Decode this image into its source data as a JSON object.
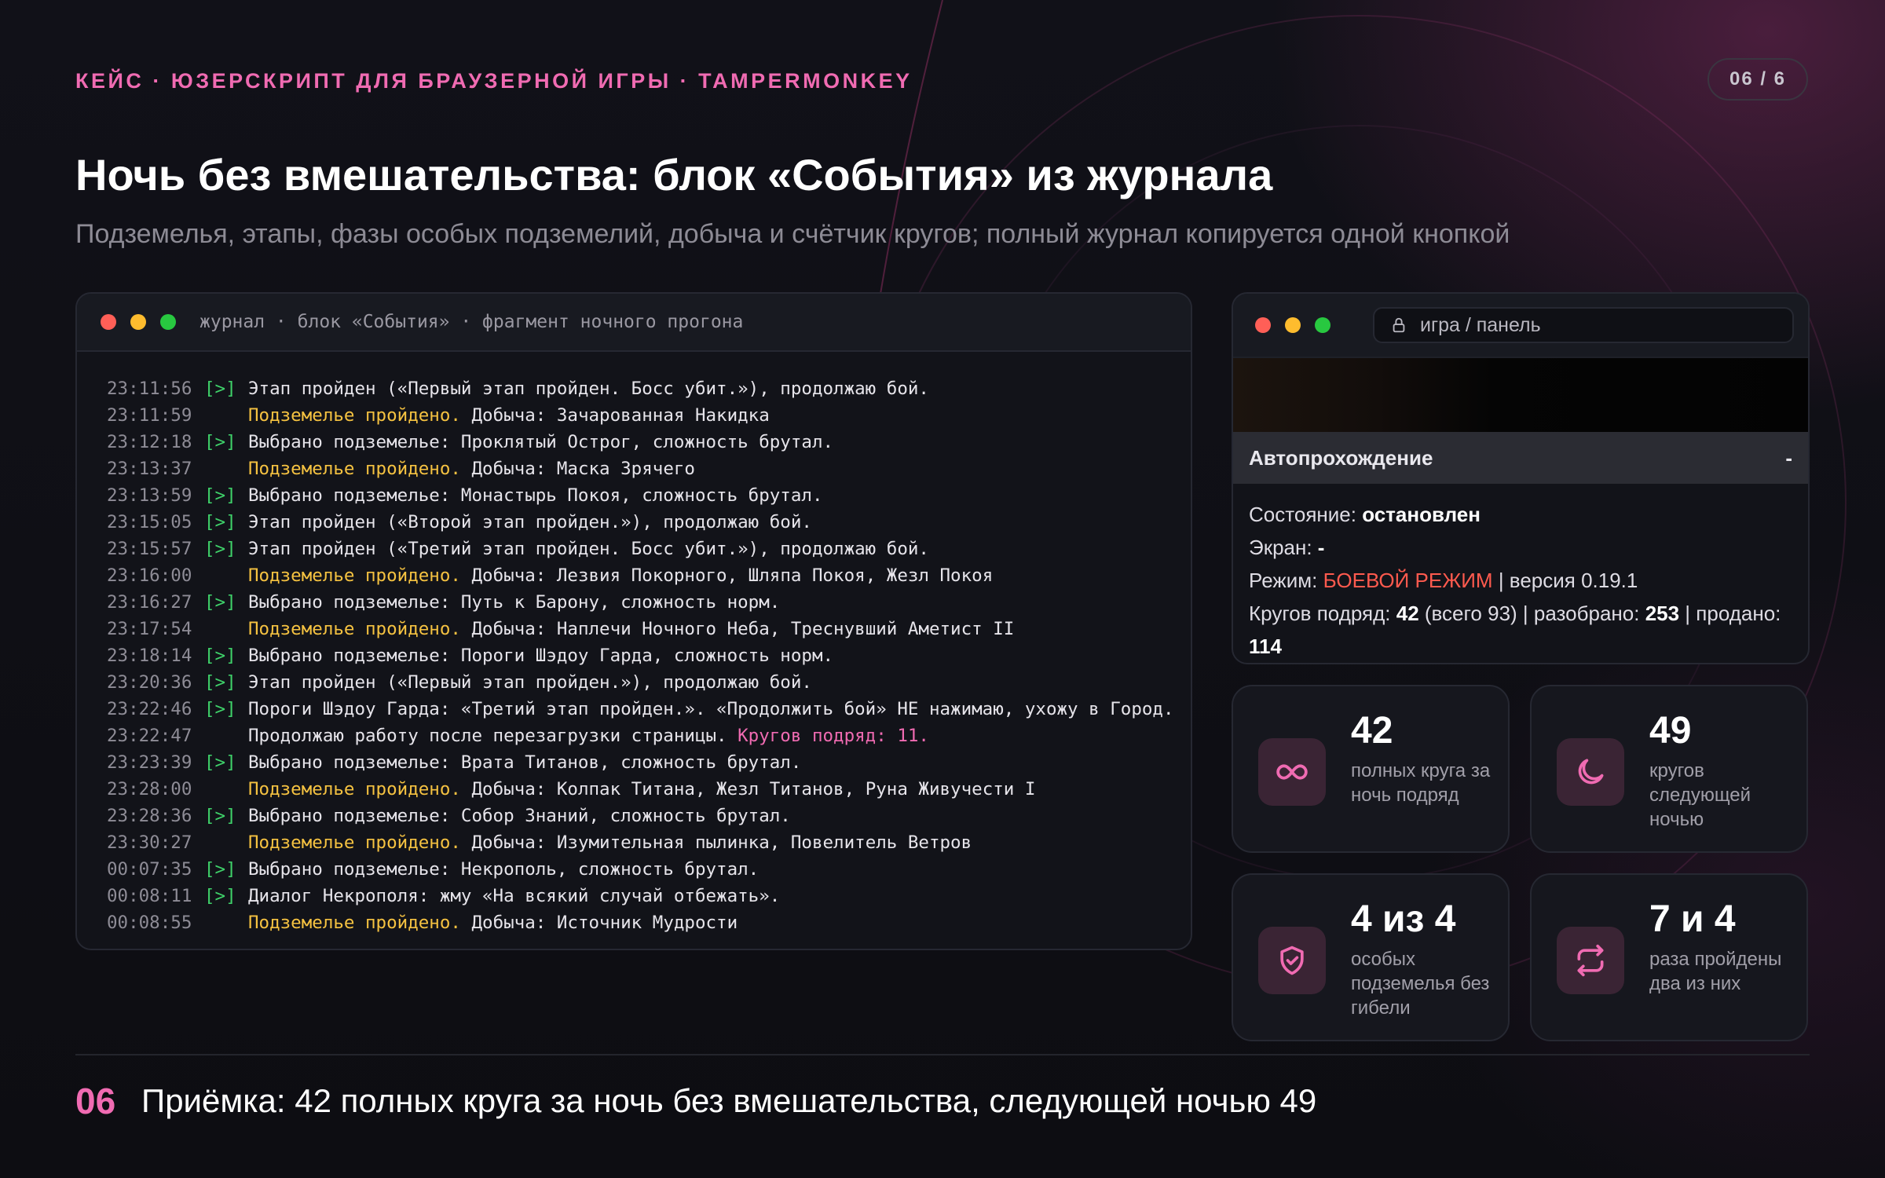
{
  "header": {
    "eyebrow": "КЕЙС · ЮЗЕРСКРИПТ ДЛЯ БРАУЗЕРНОЙ ИГРЫ · TAMPERMONKEY",
    "counter": "06 / 6",
    "title": "Ночь без вмешательства: блок «События» из журнала",
    "subtitle": "Подземелья, этапы, фазы особых подземелий, добыча и счётчик кругов; полный журнал копируется одной кнопкой"
  },
  "terminal": {
    "title": "журнал · блок «События» · фрагмент ночного прогона",
    "lines": [
      {
        "time": "23:11:56",
        "marker": "[>]",
        "done": "",
        "text": "Этап пройден («Первый этап пройден. Босс убит.»), продолжаю бой.",
        "count": ""
      },
      {
        "time": "23:11:59",
        "marker": "",
        "done": "Подземелье пройдено.",
        "text": " Добыча: Зачарованная Накидка",
        "count": ""
      },
      {
        "time": "23:12:18",
        "marker": "[>]",
        "done": "",
        "text": "Выбрано подземелье: Проклятый Острог, сложность брутал.",
        "count": ""
      },
      {
        "time": "23:13:37",
        "marker": "",
        "done": "Подземелье пройдено.",
        "text": " Добыча: Маска Зрячего",
        "count": ""
      },
      {
        "time": "23:13:59",
        "marker": "[>]",
        "done": "",
        "text": "Выбрано подземелье: Монастырь Покоя, сложность брутал.",
        "count": ""
      },
      {
        "time": "23:15:05",
        "marker": "[>]",
        "done": "",
        "text": "Этап пройден («Второй этап пройден.»), продолжаю бой.",
        "count": ""
      },
      {
        "time": "23:15:57",
        "marker": "[>]",
        "done": "",
        "text": "Этап пройден («Третий этап пройден. Босс убит.»), продолжаю бой.",
        "count": ""
      },
      {
        "time": "23:16:00",
        "marker": "",
        "done": "Подземелье пройдено.",
        "text": " Добыча: Лезвия Покорного, Шляпа Покоя, Жезл Покоя",
        "count": ""
      },
      {
        "time": "23:16:27",
        "marker": "[>]",
        "done": "",
        "text": "Выбрано подземелье: Путь к Барону, сложность норм.",
        "count": ""
      },
      {
        "time": "23:17:54",
        "marker": "",
        "done": "Подземелье пройдено.",
        "text": " Добыча: Наплечи Ночного Неба, Треснувший Аметист II",
        "count": ""
      },
      {
        "time": "23:18:14",
        "marker": "[>]",
        "done": "",
        "text": "Выбрано подземелье: Пороги Шэдоу Гарда, сложность норм.",
        "count": ""
      },
      {
        "time": "23:20:36",
        "marker": "[>]",
        "done": "",
        "text": "Этап пройден («Первый этап пройден.»), продолжаю бой.",
        "count": ""
      },
      {
        "time": "23:22:46",
        "marker": "[>]",
        "done": "",
        "text": "Пороги Шэдоу Гарда: «Третий этап пройден.». «Продолжить бой» НЕ нажимаю, ухожу в Город.",
        "count": ""
      },
      {
        "time": "23:22:47",
        "marker": "",
        "done": "",
        "text": "Продолжаю работу после перезагрузки страницы. ",
        "count": "Кругов подряд: 11."
      },
      {
        "time": "23:23:39",
        "marker": "[>]",
        "done": "",
        "text": "Выбрано подземелье: Врата Титанов, сложность брутал.",
        "count": ""
      },
      {
        "time": "23:28:00",
        "marker": "",
        "done": "Подземелье пройдено.",
        "text": " Добыча: Колпак Титана, Жезл Титанов, Руна Живучести I",
        "count": ""
      },
      {
        "time": "23:28:36",
        "marker": "[>]",
        "done": "",
        "text": "Выбрано подземелье: Собор Знаний, сложность брутал.",
        "count": ""
      },
      {
        "time": "23:30:27",
        "marker": "",
        "done": "Подземелье пройдено.",
        "text": " Добыча: Изумительная пылинка, Повелитель Ветров",
        "count": ""
      },
      {
        "time": "00:07:35",
        "marker": "[>]",
        "done": "",
        "text": "Выбрано подземелье: Некрополь, сложность брутал.",
        "count": ""
      },
      {
        "time": "00:08:11",
        "marker": "[>]",
        "done": "",
        "text": "Диалог Некрополя: жму «На всякий случай отбежать».",
        "count": ""
      },
      {
        "time": "00:08:55",
        "marker": "",
        "done": "Подземелье пройдено.",
        "text": " Добыча: Источник Мудрости",
        "count": ""
      }
    ]
  },
  "panel": {
    "url": "игра / панель",
    "header_title": "Автопрохождение",
    "collapse_label": "-",
    "state_label": "Состояние: ",
    "state_value": "остановлен",
    "screen_label": "Экран: ",
    "screen_value": "-",
    "mode_label": "Режим: ",
    "mode_value": "БОЕВОЙ РЕЖИМ",
    "mode_version": " | версия 0.19.1",
    "laps_label": "Кругов подряд: ",
    "laps_value": "42",
    "laps_total": " (всего 93) | разобрано: ",
    "disassembled_value": "253",
    "sold_label": " | продано:",
    "sold_value": "114"
  },
  "stats": [
    {
      "value": "42",
      "label": "полных круга за ночь подряд",
      "icon": "infinity-icon"
    },
    {
      "value": "49",
      "label": "кругов следующей ночью",
      "icon": "moon-icon"
    },
    {
      "value": "4 из 4",
      "label": "особых подземелья без гибели",
      "icon": "shield-check-icon"
    },
    {
      "value": "7 и 4",
      "label": "раза пройдены два из них",
      "icon": "repeat-icon"
    }
  ],
  "footer": {
    "number": "06",
    "text": "Приёмка: 42 полных круга за ночь без вмешательства, следующей ночью 49"
  },
  "colors": {
    "accent": "#f06bb2",
    "marker": "#3fd26a",
    "done": "#f5c241",
    "mode": "#ff5a4e"
  }
}
